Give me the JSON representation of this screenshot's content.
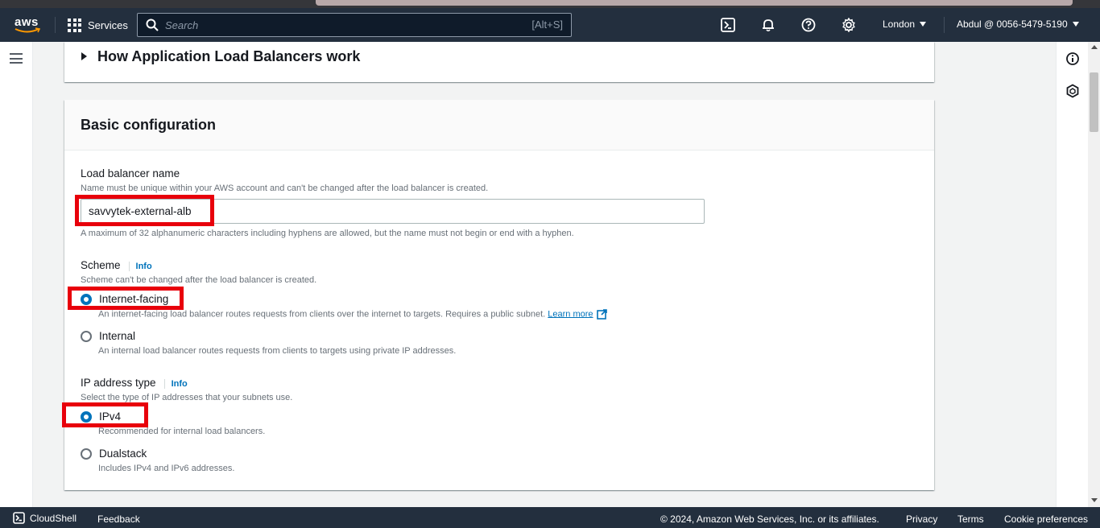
{
  "nav": {
    "logo_text": "aws",
    "services_label": "Services",
    "search_placeholder": "Search",
    "search_shortcut": "[Alt+S]",
    "region": "London",
    "account": "Abdul @ 0056-5479-5190"
  },
  "how_section": {
    "title": "How Application Load Balancers work"
  },
  "basic_config": {
    "title": "Basic configuration",
    "name_label": "Load balancer name",
    "name_desc": "Name must be unique within your AWS account and can't be changed after the load balancer is created.",
    "name_value": "savvytek-external-alb",
    "name_hint": "A maximum of 32 alphanumeric characters including hyphens are allowed, but the name must not begin or end with a hyphen.",
    "scheme": {
      "label": "Scheme",
      "info": "Info",
      "desc": "Scheme can't be changed after the load balancer is created.",
      "options": [
        {
          "label": "Internet-facing",
          "desc": "An internet-facing load balancer routes requests from clients over the internet to targets. Requires a public subnet.",
          "link": "Learn more",
          "checked": true
        },
        {
          "label": "Internal",
          "desc": "An internal load balancer routes requests from clients to targets using private IP addresses.",
          "checked": false
        }
      ]
    },
    "ip_type": {
      "label": "IP address type",
      "info": "Info",
      "desc": "Select the type of IP addresses that your subnets use.",
      "options": [
        {
          "label": "IPv4",
          "desc": "Recommended for internal load balancers.",
          "checked": true
        },
        {
          "label": "Dualstack",
          "desc": "Includes IPv4 and IPv6 addresses.",
          "checked": false
        }
      ]
    }
  },
  "footer": {
    "cloudshell": "CloudShell",
    "feedback": "Feedback",
    "copyright": "© 2024, Amazon Web Services, Inc. or its affiliates.",
    "privacy": "Privacy",
    "terms": "Terms",
    "cookies": "Cookie preferences"
  },
  "colors": {
    "nav_bg": "#232f3e",
    "accent": "#0073bb",
    "highlight": "#e8000b",
    "aws_orange": "#ff9900"
  },
  "icons": [
    "grid-icon",
    "search-icon",
    "cloudshell-icon",
    "bell-icon",
    "help-icon",
    "gear-icon",
    "hamburger-icon",
    "info-circle-icon",
    "hexagon-icon",
    "external-link-icon"
  ]
}
